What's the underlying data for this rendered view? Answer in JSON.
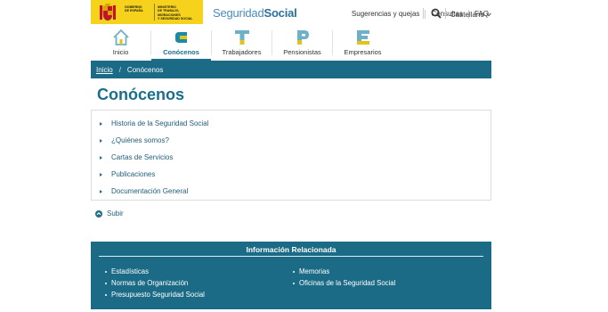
{
  "header": {
    "gov_text_left": [
      "GOBIERNO",
      "DE ESPAÑA"
    ],
    "gov_text_right": [
      "MINISTERIO",
      "DE TRABAJO, MIGRACIONES",
      "Y SEGURIDAD SOCIAL"
    ],
    "brand_light": "Seguridad",
    "brand_bold": "Social",
    "links": [
      "Sugerencias y quejas",
      "Consultas",
      "FAQ"
    ],
    "language": "Castellano",
    "colors": {
      "brand_yellow": "#f6d21d",
      "accent": "#1b6b86"
    }
  },
  "nav": {
    "items": [
      {
        "label": "Inicio",
        "icon": "house-icon"
      },
      {
        "label": "Conócenos",
        "icon": "c-letter-icon"
      },
      {
        "label": "Trabajadores",
        "icon": "t-letter-icon"
      },
      {
        "label": "Pensionistas",
        "icon": "p-letter-icon"
      },
      {
        "label": "Empresarios",
        "icon": "e-letter-icon"
      }
    ],
    "active": "Conócenos"
  },
  "breadcrumb": {
    "home": "Inicio",
    "separator": "/",
    "current": "Conócenos"
  },
  "page_title": "Conócenos",
  "links": [
    "Historia de la Seguridad Social",
    "¿Quiénes somos?",
    "Cartas de Servicios",
    "Publicaciones",
    "Documentación General"
  ],
  "subir": "Subir",
  "related": {
    "title": "Información Relacionada",
    "col1": [
      "Estadísticas",
      "Normas de Organización",
      "Presupuesto Seguridad Social"
    ],
    "col2": [
      "Memorias",
      "Oficinas de la Seguridad Social"
    ]
  }
}
